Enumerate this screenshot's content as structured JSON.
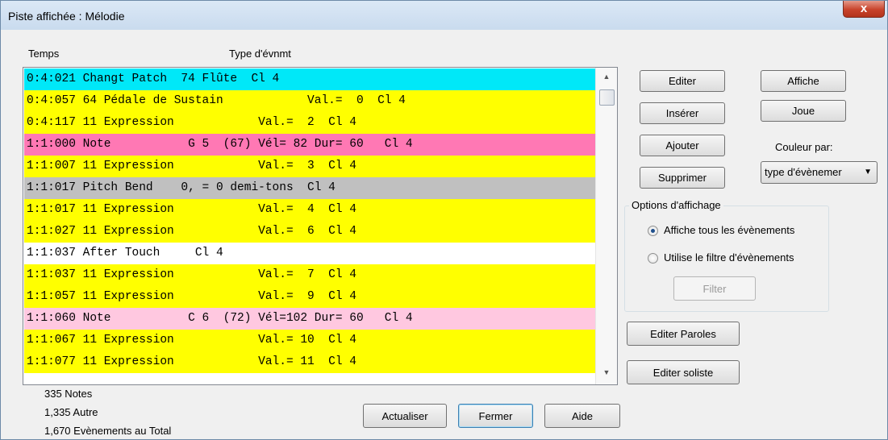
{
  "window": {
    "title": "Piste affichée : Mélodie",
    "close_glyph": "x"
  },
  "columns": {
    "time": "Temps",
    "type": "Type d'évnmt"
  },
  "events": [
    {
      "text": "0:4:021 Changt Patch  74 Flûte  Cl 4",
      "color": "#00e8f8"
    },
    {
      "text": "0:4:057 64 Pédale de Sustain            Val.=  0  Cl 4",
      "color": "#ffff00"
    },
    {
      "text": "0:4:117 11 Expression            Val.=  2  Cl 4",
      "color": "#ffff00"
    },
    {
      "text": "1:1:000 Note           G 5  (67) Vél= 82 Dur= 60   Cl 4",
      "color": "#ff78b4"
    },
    {
      "text": "1:1:007 11 Expression            Val.=  3  Cl 4",
      "color": "#ffff00"
    },
    {
      "text": "1:1:017 Pitch Bend    0, = 0 demi-tons  Cl 4",
      "color": "#c0c0c0"
    },
    {
      "text": "1:1:017 11 Expression            Val.=  4  Cl 4",
      "color": "#ffff00"
    },
    {
      "text": "1:1:027 11 Expression            Val.=  6  Cl 4",
      "color": "#ffff00"
    },
    {
      "text": "1:1:037 After Touch     Cl 4",
      "color": "#ffffff"
    },
    {
      "text": "1:1:037 11 Expression            Val.=  7  Cl 4",
      "color": "#ffff00"
    },
    {
      "text": "1:1:057 11 Expression            Val.=  9  Cl 4",
      "color": "#ffff00"
    },
    {
      "text": "1:1:060 Note           C 6  (72) Vél=102 Dur= 60   Cl 4",
      "color": "#ffc8e0"
    },
    {
      "text": "1:1:067 11 Expression            Val.= 10  Cl 4",
      "color": "#ffff00"
    },
    {
      "text": "1:1:077 11 Expression            Val.= 11  Cl 4",
      "color": "#ffff00"
    }
  ],
  "buttons": {
    "editer": "Editer",
    "affiche": "Affiche",
    "inserer": "Insérer",
    "joue": "Joue",
    "ajouter": "Ajouter",
    "supprimer": "Supprimer",
    "editer_paroles": "Editer Paroles",
    "editer_soliste": "Editer soliste",
    "actualiser": "Actualiser",
    "fermer": "Fermer",
    "aide": "Aide",
    "filter": "Filter"
  },
  "color_by": {
    "label": "Couleur par:",
    "value": "type d'évènemer"
  },
  "display_options": {
    "title": "Options d'affichage",
    "show_all": "Affiche tous les évènements",
    "use_filter": "Utilise le filtre d'évènements",
    "selected": "show_all"
  },
  "stats": {
    "notes": "335 Notes",
    "other": "1,335 Autre",
    "total": "1,670 Evènements au Total"
  }
}
